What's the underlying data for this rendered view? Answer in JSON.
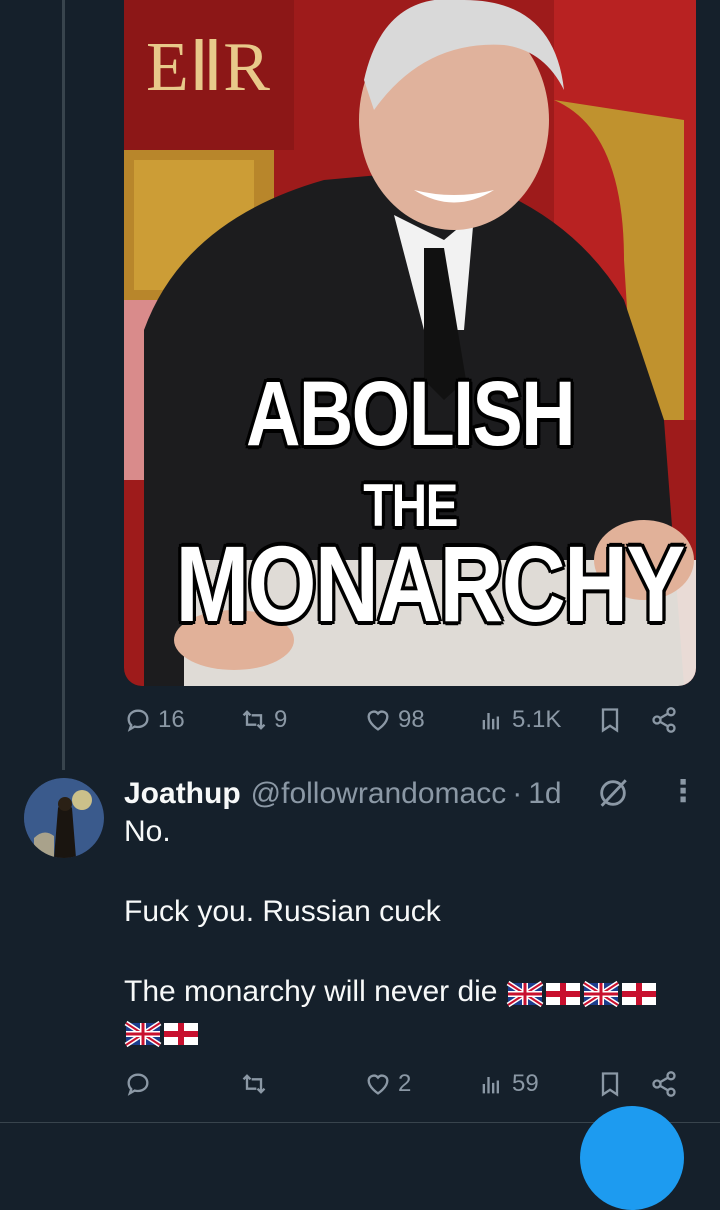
{
  "main_tweet": {
    "image": {
      "monogram": "EⅡR",
      "line1": "ABOLISH",
      "line2": "THE",
      "line3": "MONARCHY"
    },
    "actions": {
      "replies": "16",
      "retweets": "9",
      "likes": "98",
      "views": "5.1K"
    }
  },
  "reply": {
    "display_name": "Joathup",
    "handle": "@followrandomacc",
    "separator": "·",
    "time": "1d",
    "lines": [
      "No.",
      "Fuck you. Russian cuck",
      "The monarchy will never die"
    ],
    "emoji": [
      "uk-flag",
      "england-flag",
      "uk-flag",
      "england-flag",
      "uk-flag",
      "england-flag"
    ],
    "actions": {
      "replies": "",
      "retweets": "",
      "likes": "2",
      "views": "59"
    }
  },
  "icons": {
    "reply": "reply-icon",
    "retweet": "retweet-icon",
    "like": "heart-icon",
    "views": "views-icon",
    "bookmark": "bookmark-icon",
    "share": "share-icon",
    "grok": "grok-icon",
    "more": "more-icon"
  },
  "colors": {
    "background": "#15202b",
    "muted": "#8b98a5",
    "text": "#f7f9f9",
    "accent": "#1d9bf0"
  }
}
